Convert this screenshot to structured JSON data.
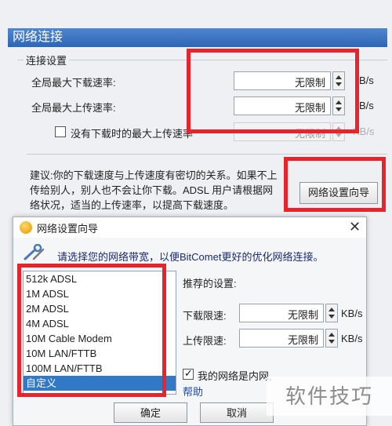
{
  "main": {
    "title": "网络连接",
    "group_title": "连接设置",
    "max_download_label": "全局最大下载速率:",
    "max_download_value": "无限制",
    "max_upload_label": "全局最大上传速率:",
    "max_upload_value": "无限制",
    "unit_bs": "B/s",
    "unit_kbs": "KB/s",
    "no_download_checkbox_label": "没有下载时的最大上传速率",
    "no_download_value": "无限制",
    "advice_text": "建议:你的下载速度与上传速度有密切的关系。如果不上\n传给别人，别人也不会让你下载。ADSL 用户请根据网\n络状况，适当的上传速率，以提高下载速度。",
    "wizard_button": "网络设置向导"
  },
  "dialog": {
    "title": "网络设置向导",
    "close_glyph": "✕",
    "prompt": "请选择您的网络带宽，以便BitComet更好的优化网络连接。",
    "bandwidth_options": [
      "512k ADSL",
      "1M ADSL",
      "2M ADSL",
      "4M ADSL",
      "10M Cable Modem",
      "10M LAN/FTTB",
      "100M LAN/FTTB",
      "自定义"
    ],
    "selected_option": "自定义",
    "recommended_label": "推荐的设置:",
    "download_limit_label": "下载限速:",
    "download_limit_value": "无限制",
    "upload_limit_label": "上传限速:",
    "upload_limit_value": "无限制",
    "unit": "KB/s",
    "lan_checkbox_label": "我的网络是内网,",
    "help_link": "帮助",
    "ok_button": "确定",
    "cancel_button": "取消"
  },
  "watermark": "软件技巧",
  "colors": {
    "highlight_red": "#e8232b",
    "header_blue": "#3a73c0",
    "selection_blue": "#3178c6",
    "link_blue": "#1549b8"
  }
}
